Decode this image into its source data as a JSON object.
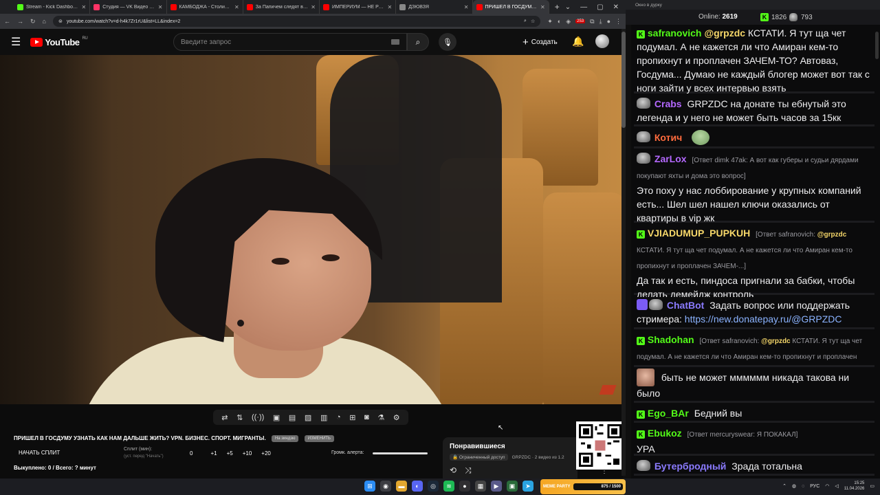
{
  "browser": {
    "tabs": [
      {
        "title": "Stream - Kick Dashboard",
        "color": "#53fc18",
        "active": false
      },
      {
        "title": "Студия — VK Видео Live",
        "color": "#ff3366",
        "active": false
      },
      {
        "title": "КАМБОДЖА - Столица Ми",
        "color": "#ff0000",
        "active": false
      },
      {
        "title": "За Папичем следят в реал",
        "color": "#ff0000",
        "active": false
      },
      {
        "title": "ИМПЕРИУМ — НЕ РОССИЯ",
        "color": "#ff0000",
        "active": false
      },
      {
        "title": "ДЗЮВЗЯ",
        "color": "#888888",
        "active": false
      },
      {
        "title": "ПРИШЕЛ В ГОСДУМУ У",
        "color": "#ff0000",
        "active": true
      }
    ],
    "url": "youtube.com/watch?v=d-h4k7Zr1rU&list=LL&index=2",
    "ext_badge": "253"
  },
  "youtube": {
    "logo": "YouTube",
    "logo_region": "RU",
    "search_placeholder": "Введите запрос",
    "create_label": "Создать"
  },
  "overlay": {
    "title": "ПРИШЕЛ В ГОСДУМУ УЗНАТЬ КАК НАМ ДАЛЬШЕ ЖИТЬ? VPN. БИЗНЕС. СПОРТ. МИГРАНТЫ.",
    "chip1": "На зиндзю",
    "chip2": "ИЗМЕНИТЬ",
    "split_button": "НАЧАТЬ СПЛИТ",
    "split_min_label": "Сплит (мин):",
    "split_hint": "(уст. перед \"Начать\")",
    "split_values": [
      "0",
      "+1",
      "+5",
      "+10",
      "+20"
    ],
    "alert_label": "Громк. алерта:",
    "alert_volume": 1.0,
    "bought_text": "Выкуплено: 0 / Всего: ? минут"
  },
  "liked": {
    "title": "Понравившиеся",
    "access": "Ограниченный доступ",
    "meta": "GRPZDC · 2 видео из 1.2"
  },
  "chat": {
    "window_title": "Окно в дурку",
    "online_label": "Online:",
    "online_count": "2619",
    "kick_count": "1826",
    "other_count": "793",
    "messages": [
      {
        "user": "safranovich",
        "color": "#53fc18",
        "badge": "kick",
        "mention": "@grpzdc",
        "text": "КСТАТИ. Я тут ща чет подумал. А не кажется ли что Амиран кем-то пропихнут и проплачен ЗАЧЕМ-ТО? Автоваз, Госдума... Думаю не каждый блогер может вот так с ноги зайти у всех интервью взять"
      },
      {
        "user": "Crabs",
        "color": "#b468ff",
        "badge": "peng",
        "text": "GRPZDC на донате ты ебнутый это легенда и у него не может быть часов за 15кк"
      },
      {
        "user": "Котич",
        "color": "#ff6b3d",
        "badge": "peng",
        "text": ""
      },
      {
        "user": "ZarLox",
        "color": "#b468ff",
        "badge": "peng",
        "reply": "[Ответ dimk 47ak: А вот как губеры и судьи дярдами покупают яхты и дома это вопрос]",
        "text": "Это поху у нас лоббирование у крупных компаний есть... Шел шел нашел ключи оказались от квартиры в vip жк"
      },
      {
        "user": "VJIADUMUP_PUPKUH",
        "color": "#f7d86a",
        "badge": "kick",
        "reply": "[Ответ safranovich:",
        "reply_mention": "@grpzdc",
        "reply_tail": "КСТАТИ. Я тут ща чет подумал. А не кажется ли что Амиран кем-то пропихнут и проплачен ЗАЧЕМ-...]",
        "text": "Да так и есть, пиндоса пригнали за бабки, чтобы делать демейдж контроль"
      },
      {
        "user": "ChatBot",
        "color": "#8b7bff",
        "badge": "bot",
        "text": "Задать вопрос или поддержать стримера:",
        "link": "https://new.donatepay.ru/@GRPZDC"
      },
      {
        "user": "Shadohan",
        "color": "#53fc18",
        "badge": "kick",
        "reply": "[Ответ safranovich:",
        "reply_mention": "@grpzdc",
        "reply_tail": "КСТАТИ. Я тут ща чет подумал. А не кажется ли что Амиран кем-то пропихнут и проплачен ЗАЧЕМ-...]",
        "text": ""
      },
      {
        "user": "",
        "color": "#ffffff",
        "badge": "photo",
        "text": "быть не может мммммм никада такова ни было"
      },
      {
        "user": "Ego_BAr",
        "color": "#53fc18",
        "badge": "kick",
        "text": "Бедний вы"
      },
      {
        "user": "Ebukoz",
        "color": "#53fc18",
        "badge": "kick",
        "reply": "[Ответ mercuryswear: Я ПОКАКАЛ]",
        "text": "УРА"
      },
      {
        "user": "Бутербродный",
        "color": "#8b7bff",
        "badge": "peng",
        "text": "Зрада тотальна"
      }
    ]
  },
  "taskbar": {
    "meme_label": "MEME PARTY",
    "meme_progress": "875 / 1500",
    "lang": "РУС",
    "time": "15:25",
    "date": "11.04.2026"
  }
}
